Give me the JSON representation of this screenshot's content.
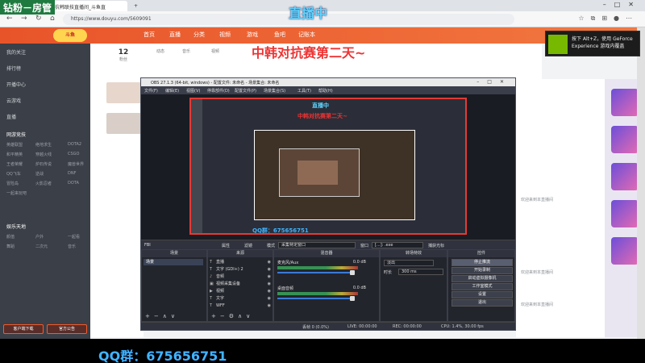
{
  "browser": {
    "tabs": [
      "",
      "抗韩联技直播间_斗鱼直",
      "+"
    ],
    "url": "https://www.douyu.com/5609091"
  },
  "overlays": {
    "top_left": "钻粉－房管",
    "live": "直播中",
    "title": "中韩对抗赛第二天~",
    "qq": "QQ群：675656751"
  },
  "site_nav": {
    "items": [
      "首页",
      "直播",
      "分类",
      "视频",
      "游戏",
      "鱼吧",
      "记账本"
    ]
  },
  "sidebar": {
    "items": [
      "我的关注",
      "排行榜",
      "开播中心",
      "云游戏",
      "直播"
    ],
    "sections": [
      {
        "head": "网游竞技",
        "subs": [
          "英雄联盟",
          "绝地求生",
          "DOTA2",
          "和平精英",
          "穿越火线",
          "CSGO",
          "王者荣耀",
          "炉石传说",
          "魔兽世界",
          "QQ飞车",
          "逆战",
          "DNF",
          "冒险岛",
          "火影忍者",
          "DOTA",
          "一起来玩吧"
        ]
      },
      {
        "head": "娱乐天地",
        "subs": [
          "颜值",
          "户外",
          "一起看",
          "舞蹈",
          "二次元",
          "音乐"
        ]
      }
    ],
    "bottom_buttons": [
      "客户端下载",
      "官方公告"
    ]
  },
  "top_stats": [
    {
      "value": "12",
      "label": "粉丝"
    },
    {
      "value": "",
      "label": "动态"
    },
    {
      "value": "",
      "label": "音乐"
    },
    {
      "value": "",
      "label": "视频"
    }
  ],
  "nvidia_toast": {
    "text": "按下 Alt+Z，使用 GeForce Experience 游戏内覆盖"
  },
  "chat": [
    {
      "tag": "",
      "text": "欢迎来到本直播间"
    },
    {
      "tag": "",
      "text": "欢迎来到本直播间"
    },
    {
      "tag": "",
      "text": "欢迎来到本直播间"
    }
  ],
  "obs": {
    "title": "OBS 27.1.3 (64-bit, windows) - 配置文件: 未命名 - 场景集合: 未命名",
    "menu": [
      "文件(F)",
      "编辑(E)",
      "视图(V)",
      "停靠部件(D)",
      "配置文件(P)",
      "场景集合(S)",
      "工具(T)",
      "帮助(H)"
    ],
    "source_bar": {
      "selected": "FBI",
      "properties": "属性",
      "filters": "滤镜",
      "mode_label": "模式",
      "mode_value": "采集特定窗口",
      "window_label": "窗口",
      "window_value": "[...]: .exe",
      "hook": "捕获光标"
    },
    "docks": {
      "scenes": "场景",
      "sources": "来源",
      "mixer": "混音器",
      "transitions": "转场特效",
      "controls": "控件"
    },
    "scene_items": [
      "场景"
    ],
    "source_items": [
      "直播",
      "文字 (GDI+) 2",
      "音频",
      "视频采集设备",
      "视频",
      "文字",
      "WFF"
    ],
    "mixer": [
      {
        "name": "麦克风/Aux",
        "db": "0.0 dB"
      },
      {
        "name": "桌面音频",
        "db": "0.0 dB"
      }
    ],
    "transitions": {
      "type": "淡出",
      "duration_label": "时长",
      "duration_value": "300 ms"
    },
    "controls": [
      "停止推流",
      "开始录制",
      "启动虚拟摄像机",
      "工作室模式",
      "设置",
      "退出"
    ],
    "status": {
      "dropped": "丢帧 0 (0.0%)",
      "live": "LIVE: 00:00:00",
      "rec": "REC: 00:00:00",
      "cpu": "CPU: 1.4%, 30.00 fps"
    }
  }
}
